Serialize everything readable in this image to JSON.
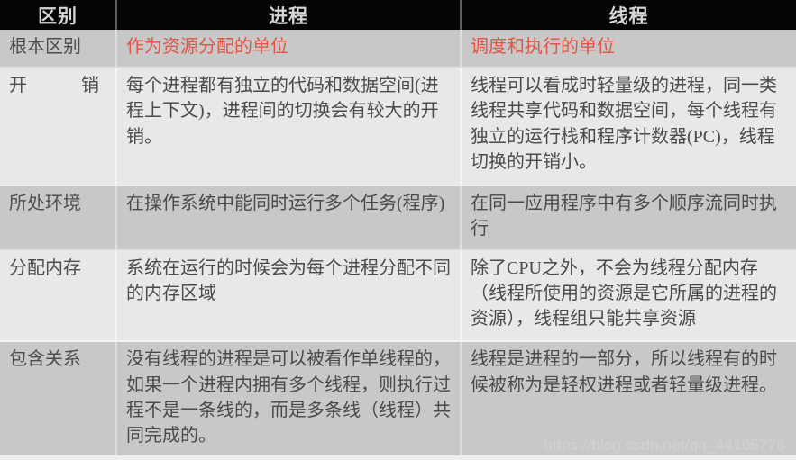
{
  "table": {
    "headers": [
      "区别",
      "进程",
      "线程"
    ],
    "rows": [
      {
        "key": "根本区别",
        "key_spread": false,
        "process": "作为资源分配的单位",
        "thread": "调度和执行的单位",
        "accent": true,
        "shade": "dark"
      },
      {
        "key": "开销",
        "key_spread": true,
        "process": "每个进程都有独立的代码和数据空间(进程上下文)，进程间的切换会有较大的开销。",
        "thread": "线程可以看成时轻量级的进程，同一类线程共享代码和数据空间，每个线程有独立的运行栈和程序计数器(PC)，线程切换的开销小。",
        "accent": false,
        "shade": "light"
      },
      {
        "key": "所处环境",
        "key_spread": false,
        "process": "在操作系统中能同时运行多个任务(程序)",
        "thread": "在同一应用程序中有多个顺序流同时执行",
        "accent": false,
        "shade": "dark"
      },
      {
        "key": "分配内存",
        "key_spread": false,
        "process": "系统在运行的时候会为每个进程分配不同的内存区域",
        "thread": "除了CPU之外，不会为线程分配内存（线程所使用的资源是它所属的进程的资源），线程组只能共享资源",
        "accent": false,
        "shade": "light"
      },
      {
        "key": "包含关系",
        "key_spread": false,
        "process": "没有线程的进程是可以被看作单线程的，如果一个进程内拥有多个线程，则执行过程不是一条线的，而是多条线（线程）共同完成的。",
        "thread": "线程是进程的一部分，所以线程有的时候被称为是轻权进程或者轻量级进程。",
        "accent": false,
        "shade": "dark"
      }
    ]
  },
  "watermark": "https://blog.csdn.net/qq_44105778",
  "colors": {
    "accent": "#e05545",
    "header_bg": "#050505",
    "header_text": "#d6d6d6",
    "row_dark": "#c8c8c8",
    "row_light": "#e8e8e8",
    "body_text": "#4a4a4a"
  }
}
